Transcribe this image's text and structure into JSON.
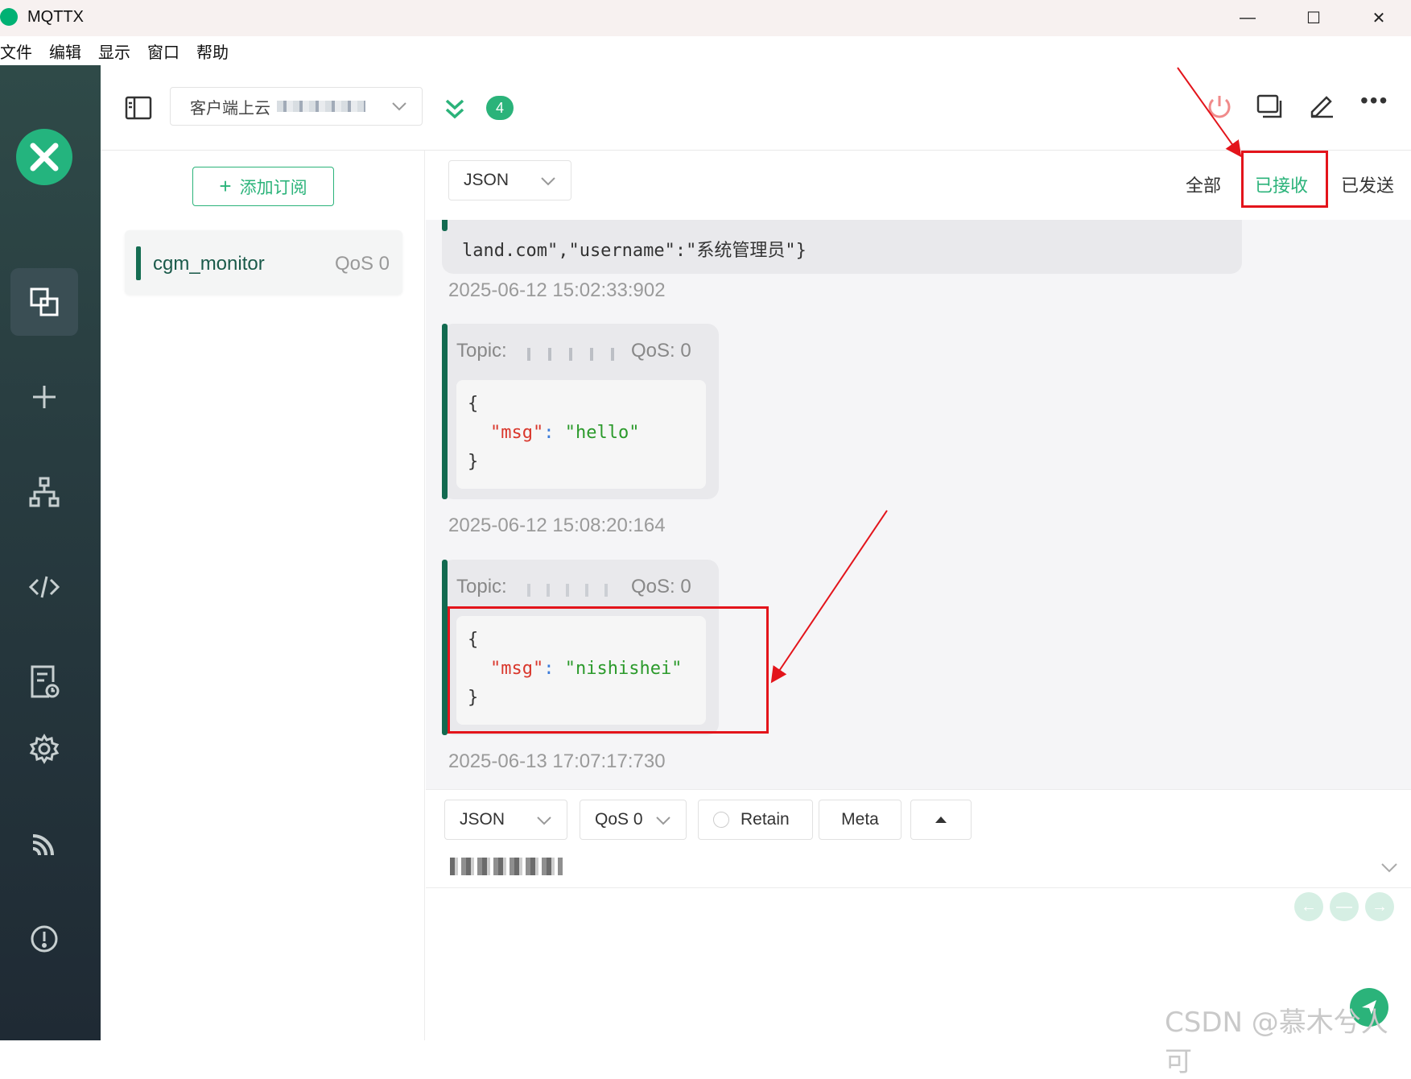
{
  "window": {
    "title": "MQTTX",
    "minimize": "—",
    "maximize": "☐",
    "close": "✕"
  },
  "menu": [
    "文件",
    "编辑",
    "显示",
    "窗口",
    "帮助"
  ],
  "header": {
    "connection_name": "客户端上云",
    "badge_count": "4"
  },
  "subscriptions": {
    "add_label": "添加订阅",
    "items": [
      {
        "topic": "cgm_monitor",
        "qos": "QoS 0"
      }
    ]
  },
  "messages": {
    "format": "JSON",
    "tabs": {
      "all": "全部",
      "received": "已接收",
      "sent": "已发送"
    },
    "partial_payload": "land.com\",\"username\":\"系统管理员\"}",
    "items": [
      {
        "time": "2025-06-12 15:02:33:902"
      },
      {
        "topic_label": "Topic:",
        "qos_label": "QoS: 0",
        "open_brace": "{",
        "key": "\"msg\"",
        "colon": ":",
        "value": "\"hello\"",
        "close_brace": "}",
        "time": "2025-06-12 15:08:20:164"
      },
      {
        "topic_label": "Topic:",
        "qos_label": "QoS: 0",
        "open_brace": "{",
        "key": "\"msg\"",
        "colon": ":",
        "value": "\"nishishei\"",
        "close_brace": "}",
        "time": "2025-06-13 17:07:17:730"
      }
    ]
  },
  "composer": {
    "format": "JSON",
    "qos": "QoS 0",
    "retain": "Retain",
    "meta": "Meta"
  },
  "watermark": "CSDN @慕木兮人可",
  "colors": {
    "accent": "#2bb37a",
    "nav_bg": "#283c40",
    "highlight": "#e3141b"
  }
}
